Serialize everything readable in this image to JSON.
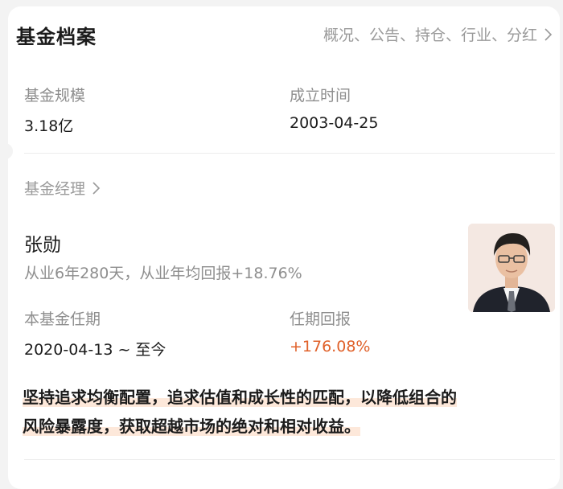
{
  "header": {
    "title": "基金档案",
    "link_label": "概况、公告、持仓、行业、分红"
  },
  "fund": {
    "size_label": "基金规模",
    "size_value": "3.18亿",
    "established_label": "成立时间",
    "established_value": "2003-04-25"
  },
  "manager": {
    "section_label": "基金经理",
    "name": "张勋",
    "description": "从业6年280天，从业年均回报+18.76%",
    "tenure_label": "本基金任期",
    "tenure_value": "2020-04-13 ~ 至今",
    "return_label": "任期回报",
    "return_value": "+176.08%",
    "quote_line1": "坚持追求均衡配置，追求估值和成长性的匹配，以降低组合的",
    "quote_line2": "风险暴露度，获取超越市场的绝对和相对收益。"
  },
  "colors": {
    "accent_return": "#e0612a",
    "highlight": "#fde8da"
  },
  "icons": {
    "header_link": "chevron-right-icon",
    "manager_link": "chevron-right-icon"
  }
}
